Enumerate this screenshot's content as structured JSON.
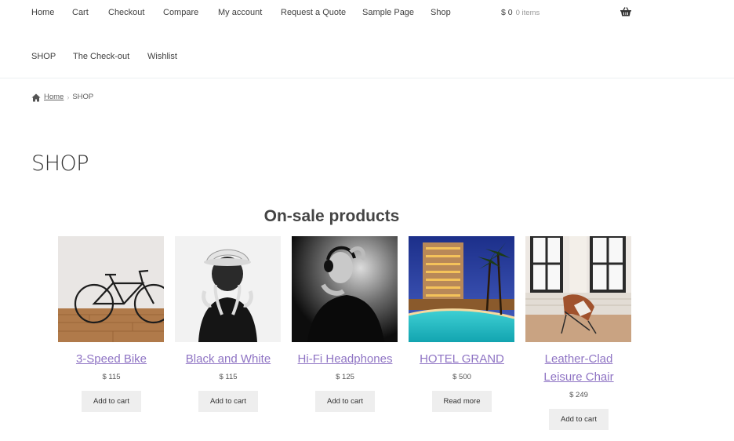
{
  "nav": {
    "items": [
      {
        "label": "Home"
      },
      {
        "label": "Cart"
      },
      {
        "label": "Checkout"
      },
      {
        "label": "Compare"
      },
      {
        "label": "My account"
      },
      {
        "label": "Request a Quote"
      },
      {
        "label": "Sample Page"
      },
      {
        "label": "Shop"
      },
      {
        "label": "SHOP"
      },
      {
        "label": "The Check-out"
      },
      {
        "label": "Wishlist"
      }
    ],
    "cart": {
      "amount": "$ 0",
      "count": "0 items",
      "icon": "basket-icon"
    }
  },
  "breadcrumb": {
    "home": "Home",
    "separator": "›",
    "current": "SHOP",
    "icon": "home-icon"
  },
  "page": {
    "title": "SHOP",
    "section_title": "On-sale products"
  },
  "products": [
    {
      "name": "3-Speed Bike",
      "price": "$ 115",
      "button": "Add to cart"
    },
    {
      "name": "Black and White",
      "price": "$ 115",
      "button": "Add to cart"
    },
    {
      "name": "Hi-Fi Headphones",
      "price": "$ 125",
      "button": "Add to cart"
    },
    {
      "name": "HOTEL GRAND",
      "price": "$ 500",
      "button": "Read more"
    },
    {
      "name": "Leather-Clad Leisure Chair",
      "price": "$ 249",
      "button": "Add to cart"
    }
  ],
  "colors": {
    "link": "#8f74c4",
    "button_bg": "#eeeeee",
    "text": "#333333"
  }
}
